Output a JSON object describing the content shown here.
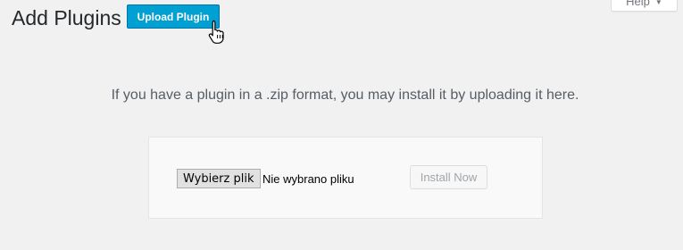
{
  "help_tab": {
    "label": "Help"
  },
  "header": {
    "title": "Add Plugins",
    "upload_button": "Upload Plugin"
  },
  "upload": {
    "help_text": "If you have a plugin in a .zip format, you may install it by uploading it here.",
    "choose_file_label": "Wybierz plik",
    "no_file_text": "Nie wybrano pliku",
    "install_button": "Install Now",
    "install_disabled": true
  },
  "colors": {
    "primary": "#00a0d2",
    "background": "#f1f1f1"
  },
  "icons": {
    "cursor": "hand-pointer-icon",
    "help_caret": "caret-down-icon"
  }
}
